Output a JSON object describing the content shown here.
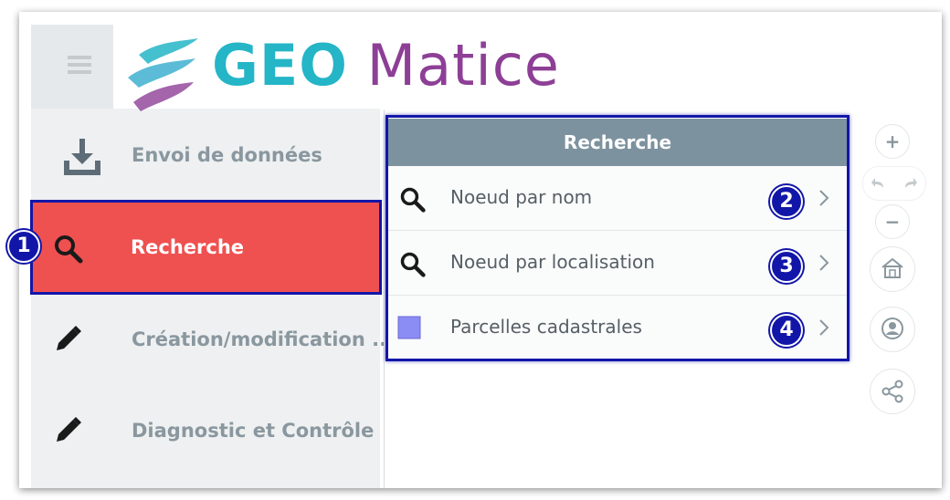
{
  "app": {
    "brand_part1": "GEO",
    "brand_part2": "Matice"
  },
  "sidebar": {
    "items": [
      {
        "label": "Envoi de données",
        "icon": "download-icon"
      },
      {
        "label": "Recherche",
        "icon": "search-icon",
        "active": true
      },
      {
        "label": "Création/modification ...",
        "icon": "pencil-icon"
      },
      {
        "label": "Diagnostic et Contrôle",
        "icon": "pencil-icon"
      }
    ]
  },
  "panel": {
    "title": "Recherche",
    "rows": [
      {
        "label": "Noeud par nom",
        "icon": "search-icon"
      },
      {
        "label": "Noeud par localisation",
        "icon": "search-icon"
      },
      {
        "label": "Parcelles cadastrales",
        "icon": "layer-square-icon"
      }
    ]
  },
  "badges": [
    "1",
    "2",
    "3",
    "4"
  ],
  "map_controls": {
    "zoom_in": "+",
    "zoom_out": "−"
  },
  "colors": {
    "brand_teal": "#24b5c7",
    "brand_purple": "#8d3f96",
    "active_item": "#ef5050",
    "panel_header": "#7d929f",
    "annotation": "#1216a8",
    "parcel_square": "#8c8cf5"
  }
}
